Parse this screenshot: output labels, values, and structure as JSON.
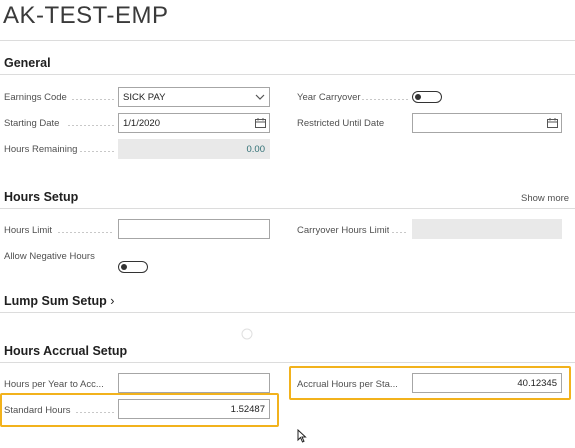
{
  "page": {
    "title": "AK-TEST-EMP"
  },
  "general": {
    "title": "General",
    "earnings_code": {
      "label": "Earnings Code",
      "value": "SICK PAY"
    },
    "starting_date": {
      "label": "Starting Date",
      "value": "1/1/2020"
    },
    "hours_remaining": {
      "label": "Hours Remaining",
      "value": "0.00"
    },
    "year_carryover": {
      "label": "Year Carryover",
      "state": "off"
    },
    "restricted_until_date": {
      "label": "Restricted Until Date",
      "value": ""
    }
  },
  "hours_setup": {
    "title": "Hours Setup",
    "show_more": "Show more",
    "hours_limit": {
      "label": "Hours Limit",
      "value": ""
    },
    "allow_negative_hours": {
      "label": "Allow Negative Hours",
      "state": "off"
    },
    "carryover_hours_limit": {
      "label": "Carryover Hours Limit",
      "value": ""
    }
  },
  "lump_sum_setup": {
    "title": "Lump Sum Setup"
  },
  "hours_accrual_setup": {
    "title": "Hours Accrual Setup",
    "hours_per_year": {
      "label": "Hours per Year to Acc...",
      "value": ""
    },
    "standard_hours": {
      "label": "Standard Hours",
      "value": "1.52487"
    },
    "accrual_hours_per_standard": {
      "label": "Accrual Hours per Sta...",
      "value": "40.12345"
    }
  },
  "colors": {
    "highlight": "#f2b21c",
    "readonly_value": "#2f6f74"
  },
  "icons": {
    "dropdown": "chevron-down-icon",
    "calendar": "calendar-icon",
    "lump_sum": "chevron-right-icon",
    "cursor": "mouse-pointer-icon"
  }
}
